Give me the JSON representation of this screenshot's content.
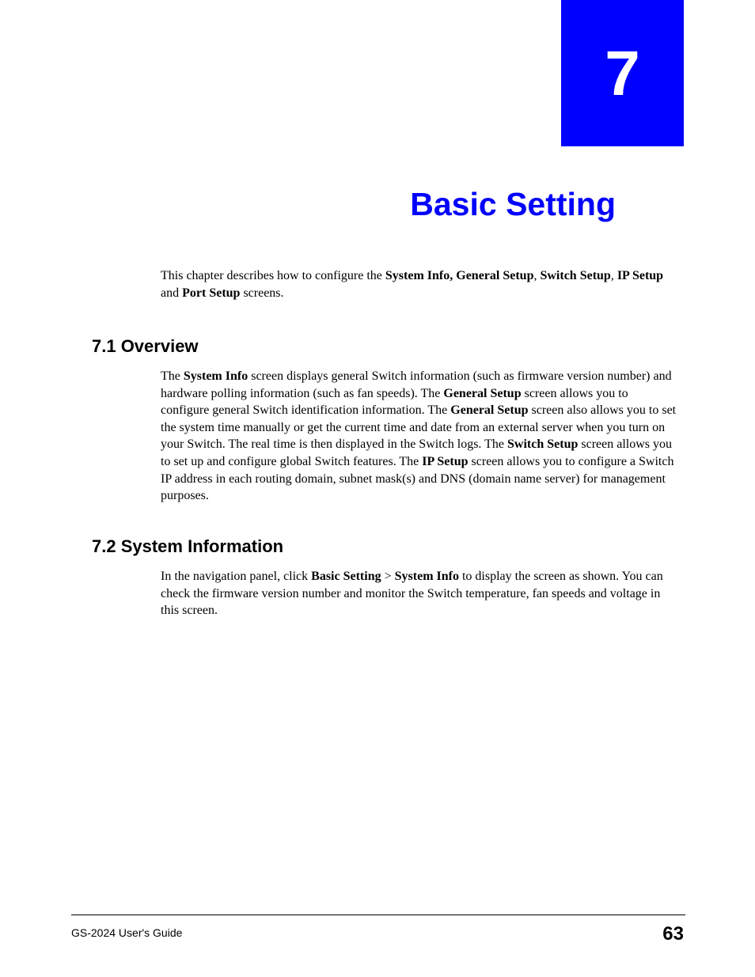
{
  "chapter": {
    "number": "7",
    "title": "Basic Setting"
  },
  "intro": {
    "pre": "This chapter describes how to configure the ",
    "b1": "System Info, General Setup",
    "s1": ", ",
    "b2": "Switch Setup",
    "s2": ", ",
    "b3": "IP Setup",
    "s3": " and ",
    "b4": "Port Setup",
    "s4": " screens."
  },
  "sections": {
    "s71": {
      "heading": "7.1  Overview",
      "p": {
        "t1": "The ",
        "b1": "System Info",
        "t2": " screen displays general Switch information (such as firmware version number) and hardware polling information (such as fan speeds). The ",
        "b2": "General Setup",
        "t3": " screen allows you to configure general Switch identification information. The ",
        "b3": "General Setup",
        "t4": " screen also allows you to set the system time manually or get the current time and date from an external server when you turn on your Switch. The real time is then displayed in the Switch logs. The ",
        "b4": "Switch Setup",
        "t5": " screen allows you to set up and configure global Switch features. The ",
        "b5": "IP Setup",
        "t6": " screen allows you to configure a Switch IP address in each routing domain, subnet mask(s) and DNS (domain name server) for management purposes."
      }
    },
    "s72": {
      "heading": "7.2  System Information",
      "p": {
        "t1": "In the navigation panel, click ",
        "b1": "Basic Setting",
        "t2": " > ",
        "b2": "System Info",
        "t3": " to display the screen as shown. You can check the firmware version number and monitor the Switch temperature, fan speeds and voltage in this screen."
      }
    }
  },
  "footer": {
    "guide": "GS-2024 User's Guide",
    "page": "63"
  }
}
